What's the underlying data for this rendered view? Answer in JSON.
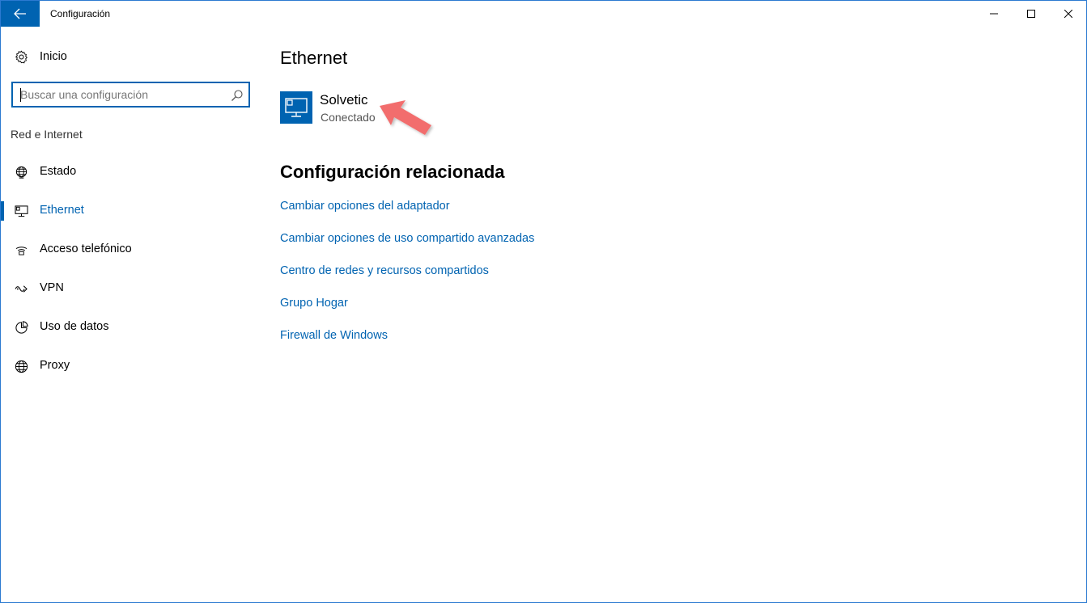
{
  "window": {
    "title": "Configuración"
  },
  "sidebar": {
    "home_label": "Inicio",
    "search_placeholder": "Buscar una configuración",
    "section_title": "Red e Internet",
    "items": [
      {
        "label": "Estado",
        "icon": "globe-network-icon"
      },
      {
        "label": "Ethernet",
        "icon": "ethernet-icon",
        "active": true
      },
      {
        "label": "Acceso telefónico",
        "icon": "dial-up-icon"
      },
      {
        "label": "VPN",
        "icon": "vpn-icon"
      },
      {
        "label": "Uso de datos",
        "icon": "data-usage-icon"
      },
      {
        "label": "Proxy",
        "icon": "globe-icon"
      }
    ]
  },
  "main": {
    "title": "Ethernet",
    "connection": {
      "name": "Solvetic",
      "status": "Conectado"
    },
    "related_title": "Configuración relacionada",
    "related_links": [
      "Cambiar opciones del adaptador",
      "Cambiar opciones de uso compartido avanzadas",
      "Centro de redes y recursos compartidos",
      "Grupo Hogar",
      "Firewall de Windows"
    ]
  },
  "colors": {
    "accent": "#0063b1",
    "annotation_arrow": "#f26d6d"
  }
}
